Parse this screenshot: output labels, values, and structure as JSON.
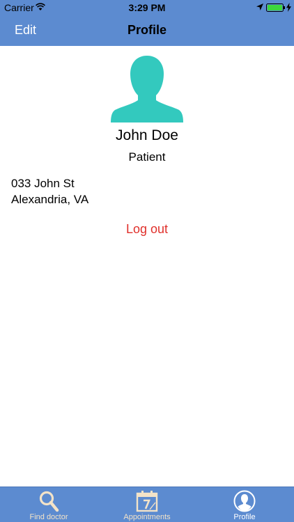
{
  "status_bar": {
    "carrier": "Carrier",
    "time": "3:29 PM"
  },
  "nav": {
    "left_button": "Edit",
    "title": "Profile"
  },
  "profile": {
    "avatar_icon": "person-silhouette-icon",
    "avatar_color": "#33C9BE",
    "name": "John Doe",
    "role": "Patient",
    "address_line1": "033 John St",
    "address_line2": "Alexandria, VA",
    "logout_label": "Log out"
  },
  "tabbar": {
    "tabs": [
      {
        "label": "Find doctor",
        "icon": "magnifier-icon",
        "selected": false
      },
      {
        "label": "Appointments",
        "icon": "calendar-icon",
        "selected": false
      },
      {
        "label": "Profile",
        "icon": "profile-circle-icon",
        "selected": true
      }
    ]
  },
  "colors": {
    "bar_blue": "#5C8BD0",
    "logout_red": "#E0302B",
    "tab_icon_tan": "#F3E3C8",
    "avatar_teal": "#33C9BE"
  }
}
